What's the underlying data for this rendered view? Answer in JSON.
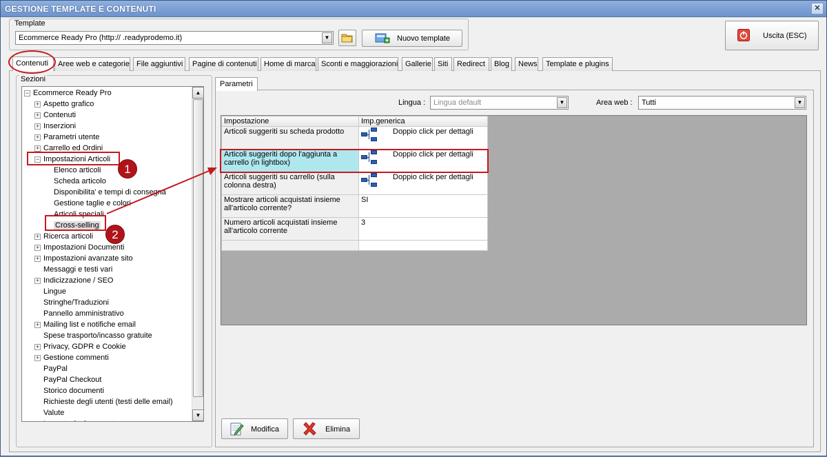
{
  "window": {
    "title": "GESTIONE TEMPLATE E CONTENUTI",
    "close_glyph": "✕"
  },
  "template": {
    "group_label": "Template",
    "selected": "Ecommerce Ready Pro (http://        .readyprodemo.it)",
    "new_button": "Nuovo template",
    "folder_icon": "folder-icon",
    "new_icon": "add-template-icon"
  },
  "exit_button": "Uscita (ESC)",
  "tabs": [
    {
      "label": "Contenuti",
      "active": true
    },
    {
      "label": "Aree web e categorie"
    },
    {
      "label": "File aggiuntivi"
    },
    {
      "label": "Pagine di contenuti"
    },
    {
      "label": "Home di marca"
    },
    {
      "label": "Sconti e maggiorazioni"
    },
    {
      "label": "Gallerie"
    },
    {
      "label": "Siti"
    },
    {
      "label": "Redirect"
    },
    {
      "label": "Blog"
    },
    {
      "label": "News"
    },
    {
      "label": "Template e plugins"
    }
  ],
  "sezioni": {
    "label": "Sezioni",
    "tree": [
      {
        "label": "Ecommerce Ready Pro",
        "level": 0,
        "expander": "−"
      },
      {
        "label": "Aspetto grafico",
        "level": 1,
        "expander": "+"
      },
      {
        "label": "Contenuti",
        "level": 1,
        "expander": "+"
      },
      {
        "label": "Inserzioni",
        "level": 1,
        "expander": "+"
      },
      {
        "label": "Parametri utente",
        "level": 1,
        "expander": "+"
      },
      {
        "label": "Carrello ed Ordini",
        "level": 1,
        "expander": "+"
      },
      {
        "label": "Impostazioni Articoli",
        "level": 1,
        "expander": "−"
      },
      {
        "label": "Elenco articoli",
        "level": 2
      },
      {
        "label": "Scheda articolo",
        "level": 2
      },
      {
        "label": "Disponibilita' e tempi di consegna",
        "level": 2
      },
      {
        "label": "Gestione taglie e colori",
        "level": 2
      },
      {
        "label": "Articoli speciali",
        "level": 2
      },
      {
        "label": "Cross-selling",
        "level": 2,
        "selected": true
      },
      {
        "label": "Ricerca articoli",
        "level": 1,
        "expander": "+"
      },
      {
        "label": "Impostazioni Documenti",
        "level": 1,
        "expander": "+"
      },
      {
        "label": "Impostazioni avanzate sito",
        "level": 1,
        "expander": "+"
      },
      {
        "label": "Messaggi e testi vari",
        "level": 1
      },
      {
        "label": "Indicizzazione / SEO",
        "level": 1,
        "expander": "+"
      },
      {
        "label": "Lingue",
        "level": 1
      },
      {
        "label": "Stringhe/Traduzioni",
        "level": 1
      },
      {
        "label": "Pannello amministrativo",
        "level": 1
      },
      {
        "label": "Mailing list e notifiche email",
        "level": 1,
        "expander": "+"
      },
      {
        "label": "Spese trasporto/incasso gratuite",
        "level": 1
      },
      {
        "label": "Privacy, GDPR e Cookie",
        "level": 1,
        "expander": "+"
      },
      {
        "label": "Gestione commenti",
        "level": 1,
        "expander": "+"
      },
      {
        "label": "PayPal",
        "level": 1
      },
      {
        "label": "PayPal Checkout",
        "level": 1
      },
      {
        "label": "Storico documenti",
        "level": 1
      },
      {
        "label": "Richieste degli utenti (testi delle email)",
        "level": 1
      },
      {
        "label": "Valute",
        "level": 1
      },
      {
        "label": "Impostazioni avanzate",
        "level": 1
      }
    ]
  },
  "parametri": {
    "tab": "Parametri",
    "lingua_label": "Lingua :",
    "lingua_value": "Lingua default",
    "area_label": "Area web :",
    "area_value": "Tutti",
    "columns": [
      "Impostazione",
      "Imp.generica"
    ],
    "rows": [
      {
        "setting": "Articoli suggeriti su scheda prodotto",
        "value": "Doppio click per dettagli",
        "icon": "flowchart-icon"
      },
      {
        "setting": "Articoli suggeriti dopo l'aggiunta a carrello (in lightbox)",
        "value": "Doppio click per dettagli",
        "icon": "flowchart-icon",
        "highlighted": true
      },
      {
        "setting": "Articoli suggeriti su carrello (sulla colonna destra)",
        "value": "Doppio click per dettagli",
        "icon": "flowchart-icon"
      },
      {
        "setting": "Mostrare articoli acquistati insieme all'articolo corrente?",
        "value": "SI"
      },
      {
        "setting": "Numero articoli acquistati insieme all'articolo corrente",
        "value": "3"
      }
    ],
    "modifica": "Modifica",
    "elimina": "Elimina"
  },
  "annotations": {
    "badge1": "1",
    "badge2": "2"
  },
  "colors": {
    "annotation_red": "#c4191f",
    "highlight_cyan": "#aee8ee",
    "title_blue": "#6d93cc"
  }
}
